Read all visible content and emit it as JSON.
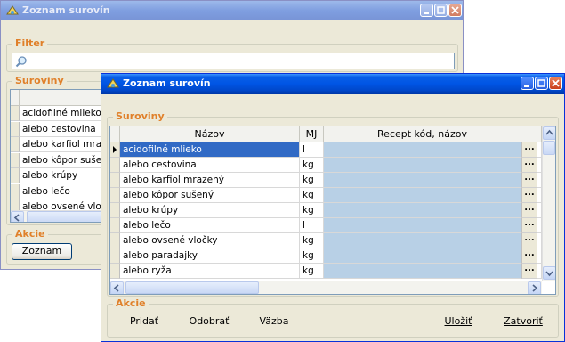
{
  "back_window": {
    "title": "Zoznam surovín",
    "filter_label": "Filter",
    "search_value": "",
    "suroviny_label": "Suroviny",
    "rows": [
      "acidofilné mlieko",
      "alebo cestovina",
      "alebo karfiol mrazený",
      "alebo kôpor sušený",
      "alebo krúpy",
      "alebo lečo",
      "alebo ovsené vločky"
    ],
    "akcie_label": "Akcie",
    "zoznam_button": "Zoznam"
  },
  "front_window": {
    "title": "Zoznam surovín",
    "suroviny_label": "Suroviny",
    "columns": {
      "nazov": "Názov",
      "mj": "MJ",
      "recept": "Recept kód, názov"
    },
    "rows": [
      {
        "nazov": "acidofilné mlieko",
        "mj": "l",
        "recept": "",
        "selected": true
      },
      {
        "nazov": "alebo cestovina",
        "mj": "kg",
        "recept": ""
      },
      {
        "nazov": "alebo karfiol mrazený",
        "mj": "kg",
        "recept": ""
      },
      {
        "nazov": "alebo kôpor sušený",
        "mj": "kg",
        "recept": ""
      },
      {
        "nazov": "alebo krúpy",
        "mj": "kg",
        "recept": ""
      },
      {
        "nazov": "alebo lečo",
        "mj": "l",
        "recept": ""
      },
      {
        "nazov": "alebo ovsené vločky",
        "mj": "kg",
        "recept": ""
      },
      {
        "nazov": "alebo paradajky",
        "mj": "kg",
        "recept": ""
      },
      {
        "nazov": "alebo ryža",
        "mj": "kg",
        "recept": ""
      }
    ],
    "ellipsis": "...",
    "akcie_label": "Akcie",
    "buttons": {
      "pridat": "Pridať",
      "odobrat": "Odobrať",
      "vazba": "Väzba",
      "ulozit": "Uložiť",
      "zatvorit": "Zatvoriť"
    }
  },
  "icons": [
    "app-icon",
    "minimize-icon",
    "maximize-icon",
    "close-icon",
    "search-icon",
    "row-pointer-icon",
    "arrow-up-icon",
    "arrow-down-icon",
    "arrow-left-icon",
    "arrow-right-icon"
  ],
  "colors": {
    "titlebar": "#0055e5",
    "group_label": "#e0802a",
    "selection": "#316ac5",
    "recept_cell": "#b8d0e6",
    "face": "#ece9d8"
  }
}
